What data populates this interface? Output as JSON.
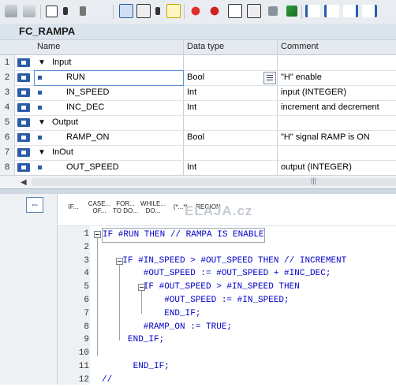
{
  "toolbar": {
    "icons": [
      "insert-network-icon",
      "delete-network-icon",
      "insert-row-icon",
      "add-row-icon",
      "delete-row-icon",
      "monitoring-icon",
      "view-list-icon",
      "view-tree-icon",
      "download-icon",
      "open-block-icon",
      "breakpoint-icon",
      "clear-breakpoints-icon",
      "go-to-icon",
      "run-icon",
      "step-icon",
      "compile-icon",
      "indent-icon",
      "outdent-icon",
      "comment-icon",
      "uncomment-icon"
    ]
  },
  "block": {
    "name": "FC_RAMPA"
  },
  "table": {
    "headers": {
      "name": "Name",
      "datatype": "Data type",
      "comment": "Comment"
    },
    "rows": [
      {
        "num": "1",
        "name": "Input",
        "datatype": "",
        "comment": "",
        "section": true
      },
      {
        "num": "2",
        "name": "RUN",
        "datatype": "Bool",
        "comment": "\"H\" enable",
        "section": false
      },
      {
        "num": "3",
        "name": "IN_SPEED",
        "datatype": "Int",
        "comment": "input (INTEGER)",
        "section": false
      },
      {
        "num": "4",
        "name": "INC_DEC",
        "datatype": "Int",
        "comment": "increment and decrement",
        "section": false
      },
      {
        "num": "5",
        "name": "Output",
        "datatype": "",
        "comment": "",
        "section": true
      },
      {
        "num": "6",
        "name": "RAMP_ON",
        "datatype": "Bool",
        "comment": "\"H\" signal RAMP is ON",
        "section": false
      },
      {
        "num": "7",
        "name": "InOut",
        "datatype": "",
        "comment": "",
        "section": true
      },
      {
        "num": "8",
        "name": "OUT_SPEED",
        "datatype": "Int",
        "comment": "output (INTEGER)",
        "section": false
      }
    ],
    "selected_row": "2"
  },
  "code_toolbar": {
    "buttons": [
      "IF...",
      "CASE...\nOF...",
      "FOR...\nTO DO...",
      "WHILE...\nDO...",
      "(*...*)",
      "REGION"
    ]
  },
  "watermark": "ELAJA.cz",
  "code": {
    "lines": [
      {
        "num": "1",
        "text": "IF #RUN THEN // RAMPA IS ENABLE",
        "fold": true
      },
      {
        "num": "2",
        "text": "",
        "fold": false
      },
      {
        "num": "3",
        "text": "    IF #IN_SPEED > #OUT_SPEED THEN // INCREMENT",
        "fold": true
      },
      {
        "num": "4",
        "text": "        #OUT_SPEED := #OUT_SPEED + #INC_DEC;",
        "fold": false
      },
      {
        "num": "5",
        "text": "        IF #OUT_SPEED > #IN_SPEED THEN",
        "fold": true
      },
      {
        "num": "6",
        "text": "            #OUT_SPEED := #IN_SPEED;",
        "fold": false
      },
      {
        "num": "7",
        "text": "            END_IF;",
        "fold": false
      },
      {
        "num": "8",
        "text": "        #RAMP_ON := TRUE;",
        "fold": false
      },
      {
        "num": "9",
        "text": "     END_IF;",
        "fold": false
      },
      {
        "num": "10",
        "text": "",
        "fold": false
      },
      {
        "num": "11",
        "text": "      END_IF;",
        "fold": false
      },
      {
        "num": "12",
        "text": "//",
        "fold": false
      }
    ]
  },
  "colors": {
    "keyword": "#0000c8",
    "accent": "#2a5ca8"
  }
}
